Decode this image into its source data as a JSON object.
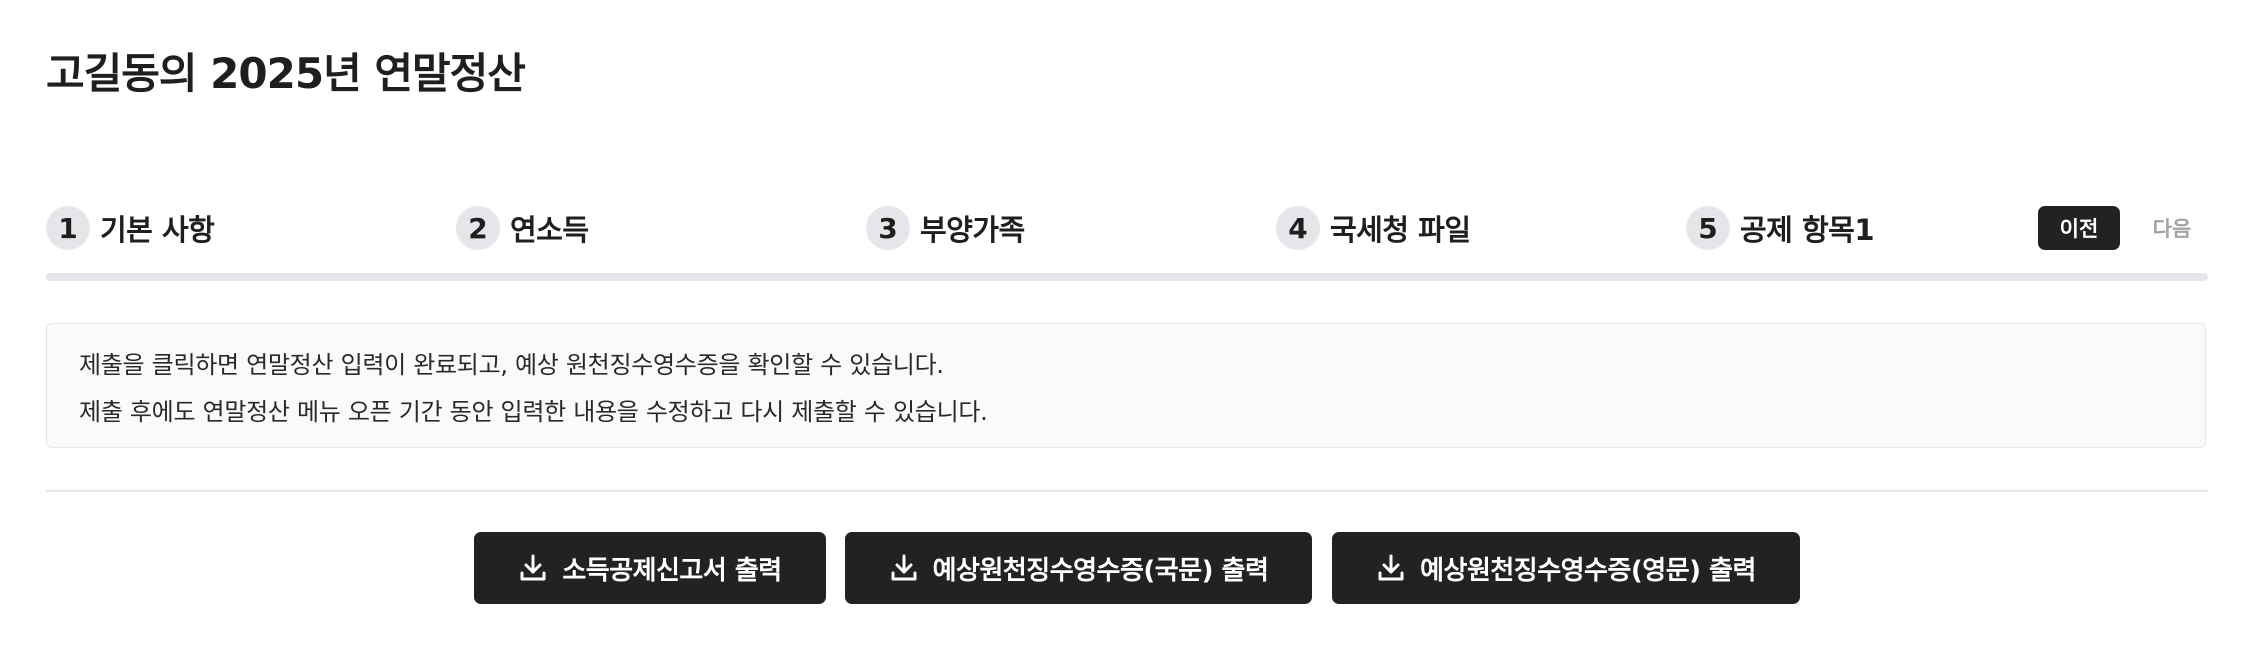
{
  "page": {
    "title": "고길동의 2025년 연말정산"
  },
  "steps": [
    {
      "number": "1",
      "label": "기본 사항"
    },
    {
      "number": "2",
      "label": "연소득"
    },
    {
      "number": "3",
      "label": "부양가족"
    },
    {
      "number": "4",
      "label": "국세청 파일"
    },
    {
      "number": "5",
      "label": "공제 항목1"
    }
  ],
  "nav": {
    "prev_label": "이전",
    "next_label": "다음"
  },
  "notice": {
    "lines": [
      "제출을 클릭하면 연말정산 입력이 완료되고, 예상 원천징수영수증을 확인할 수 있습니다.",
      "제출 후에도 연말정산 메뉴 오픈 기간 동안 입력한 내용을 수정하고 다시 제출할 수 있습니다."
    ]
  },
  "actions": [
    {
      "label": "소득공제신고서 출력",
      "icon": "download-icon"
    },
    {
      "label": "예상원천징수영수증(국문) 출력",
      "icon": "download-icon"
    },
    {
      "label": "예상원천징수영수증(영문) 출력",
      "icon": "download-icon"
    }
  ],
  "colors": {
    "primary_button": "#222222",
    "step_circle": "#e6e6ea",
    "disabled_text": "#a3a3a3"
  }
}
